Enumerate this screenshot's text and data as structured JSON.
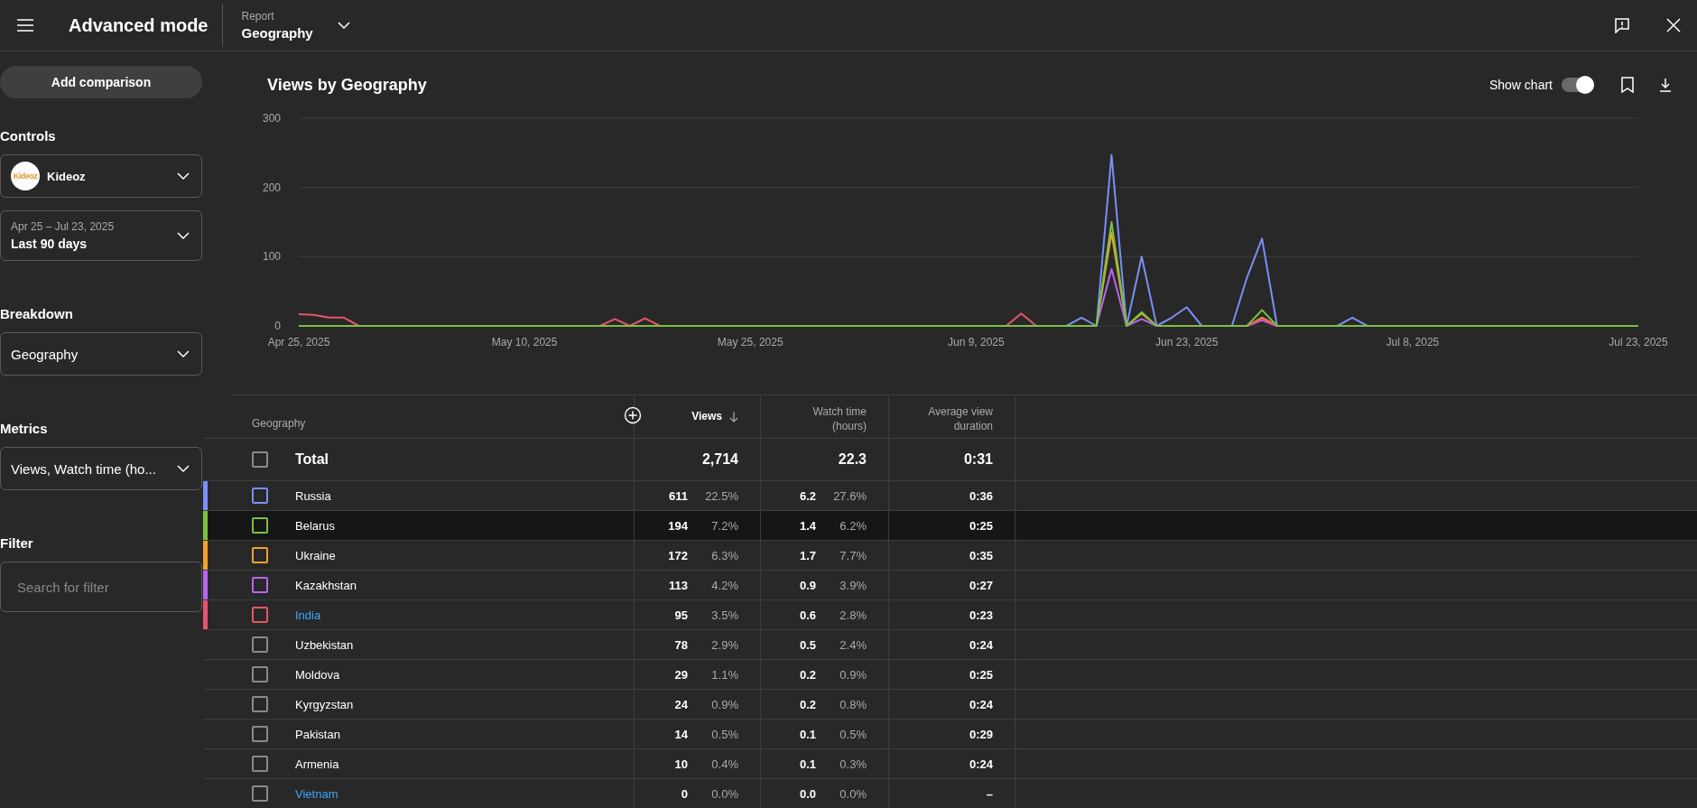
{
  "header": {
    "title": "Advanced mode",
    "report_label": "Report",
    "report_value": "Geography"
  },
  "sidebar": {
    "add_comparison": "Add comparison",
    "sections": [
      {
        "heading": "Controls",
        "fields": [
          {
            "kind": "channel",
            "value": "Kideoz",
            "logo": "Kideoz"
          },
          {
            "kind": "daterange",
            "caption": "Apr 25 – Jul 23, 2025",
            "value": "Last 90 days"
          }
        ]
      },
      {
        "heading": "Breakdown",
        "fields": [
          {
            "kind": "plain",
            "value": "Geography"
          }
        ]
      },
      {
        "heading": "Metrics",
        "fields": [
          {
            "kind": "plain",
            "value": "Views, Watch time (ho..."
          }
        ]
      },
      {
        "heading": "Filter",
        "fields": [
          {
            "kind": "search",
            "placeholder": "Search for filter"
          }
        ]
      }
    ]
  },
  "chart_panel": {
    "title": "Views by Geography",
    "show_chart_label": "Show chart",
    "show_chart_on": true,
    "chart_data": {
      "type": "line",
      "ylim": [
        0,
        300
      ],
      "yticks": [
        0,
        100,
        200,
        300
      ],
      "categories": [
        "Apr 25, 2025",
        null,
        null,
        null,
        null,
        null,
        null,
        null,
        null,
        null,
        null,
        null,
        null,
        null,
        null,
        "May 10, 2025",
        null,
        null,
        null,
        null,
        null,
        null,
        null,
        null,
        null,
        null,
        null,
        null,
        null,
        null,
        "May 25, 2025",
        null,
        null,
        null,
        null,
        null,
        null,
        null,
        null,
        null,
        null,
        null,
        null,
        null,
        null,
        "Jun 9, 2025",
        null,
        null,
        null,
        null,
        null,
        null,
        null,
        null,
        null,
        null,
        null,
        null,
        null,
        "Jun 23, 2025",
        null,
        null,
        null,
        null,
        null,
        null,
        null,
        null,
        null,
        null,
        null,
        null,
        null,
        null,
        "Jul 8, 2025",
        null,
        null,
        null,
        null,
        null,
        null,
        null,
        null,
        null,
        null,
        null,
        null,
        null,
        null,
        "Jul 23, 2025"
      ],
      "series": [
        {
          "color": "#7b8ff7",
          "values": [
            null,
            null,
            null,
            null,
            null,
            null,
            null,
            null,
            null,
            null,
            null,
            null,
            null,
            null,
            null,
            null,
            null,
            null,
            null,
            null,
            null,
            null,
            null,
            null,
            null,
            null,
            null,
            null,
            null,
            null,
            null,
            null,
            null,
            null,
            null,
            null,
            null,
            null,
            null,
            null,
            null,
            null,
            null,
            null,
            null,
            null,
            null,
            null,
            null,
            null,
            null,
            0,
            12,
            0,
            247,
            0,
            100,
            0,
            12,
            27,
            0,
            null,
            0,
            70,
            126,
            0,
            null,
            null,
            null,
            0,
            12,
            0,
            null,
            null,
            null,
            null,
            null,
            null,
            null,
            null,
            null,
            null,
            null,
            null,
            null,
            null,
            null,
            null,
            null,
            null
          ]
        },
        {
          "color": "#f2a22c",
          "values": [
            null,
            null,
            null,
            null,
            null,
            null,
            null,
            null,
            null,
            null,
            null,
            null,
            null,
            null,
            null,
            null,
            null,
            null,
            null,
            null,
            null,
            null,
            null,
            null,
            null,
            null,
            null,
            null,
            null,
            null,
            null,
            null,
            null,
            null,
            null,
            null,
            null,
            null,
            null,
            null,
            null,
            null,
            null,
            null,
            null,
            null,
            null,
            null,
            null,
            null,
            null,
            null,
            null,
            0,
            135,
            0,
            18,
            0,
            null,
            null,
            null,
            null,
            null,
            0,
            12,
            0,
            null,
            null,
            null,
            null,
            null,
            null,
            null,
            null,
            null,
            null,
            null,
            null,
            null,
            null,
            null,
            null,
            null,
            null,
            null,
            null,
            null,
            null,
            null,
            null
          ]
        },
        {
          "color": "#b666f0",
          "values": [
            null,
            null,
            null,
            null,
            null,
            null,
            null,
            null,
            null,
            null,
            null,
            null,
            null,
            null,
            null,
            null,
            null,
            null,
            null,
            null,
            null,
            null,
            null,
            null,
            null,
            null,
            null,
            null,
            null,
            null,
            null,
            null,
            null,
            null,
            null,
            null,
            null,
            null,
            null,
            null,
            null,
            null,
            null,
            null,
            null,
            null,
            null,
            null,
            null,
            null,
            null,
            null,
            null,
            0,
            82,
            0,
            10,
            0,
            null,
            null,
            null,
            null,
            null,
            0,
            8,
            0,
            null,
            null,
            null,
            null,
            null,
            null,
            null,
            null,
            null,
            null,
            null,
            null,
            null,
            null,
            null,
            null,
            null,
            null,
            null,
            null,
            null,
            null,
            null,
            null
          ]
        },
        {
          "color": "#e8546e",
          "values": [
            17,
            16,
            12,
            12,
            0,
            null,
            null,
            null,
            null,
            null,
            null,
            null,
            null,
            null,
            null,
            null,
            null,
            null,
            null,
            null,
            0,
            10,
            0,
            11,
            0,
            null,
            null,
            null,
            null,
            null,
            null,
            null,
            null,
            null,
            null,
            null,
            null,
            null,
            null,
            null,
            null,
            null,
            null,
            null,
            null,
            null,
            null,
            0,
            18,
            0,
            null,
            null,
            null,
            null,
            null,
            null,
            null,
            null,
            null,
            null,
            null,
            null,
            null,
            0,
            10,
            0,
            null,
            null,
            null,
            null,
            null,
            null,
            null,
            null,
            null,
            null,
            null,
            null,
            null,
            null,
            null,
            null,
            null,
            null,
            null,
            null,
            null,
            null,
            null,
            null
          ]
        },
        {
          "color": "#7ac142",
          "values": [
            0,
            0,
            0,
            0,
            0,
            0,
            0,
            0,
            0,
            0,
            0,
            0,
            0,
            0,
            0,
            0,
            0,
            0,
            0,
            0,
            0,
            0,
            0,
            0,
            0,
            0,
            0,
            0,
            0,
            0,
            0,
            0,
            0,
            0,
            0,
            0,
            0,
            0,
            0,
            0,
            0,
            0,
            0,
            0,
            0,
            0,
            0,
            0,
            0,
            0,
            0,
            0,
            0,
            0,
            150,
            0,
            20,
            0,
            0,
            0,
            0,
            0,
            0,
            0,
            23,
            0,
            0,
            0,
            0,
            0,
            0,
            0,
            0,
            0,
            0,
            0,
            0,
            0,
            0,
            0,
            0,
            0,
            0,
            0,
            0,
            0,
            0,
            0,
            0,
            0
          ]
        }
      ]
    }
  },
  "table": {
    "columns": [
      {
        "label": "Geography",
        "sorted": false
      },
      {
        "label": "Views",
        "sorted": true
      },
      {
        "label": "Watch time (hours)",
        "sorted": false
      },
      {
        "label": "Average view duration",
        "sorted": false
      }
    ],
    "total": {
      "label": "Total",
      "checked": false,
      "views": "2,714",
      "watch": "22.3",
      "avg": "0:31"
    },
    "rows": [
      {
        "name": "Russia",
        "color": "#7b8ff7",
        "checked": false,
        "link": false,
        "highlighted": false,
        "views": "611",
        "views_pct": "22.5%",
        "watch": "6.2",
        "watch_pct": "27.6%",
        "avg": "0:36"
      },
      {
        "name": "Belarus",
        "color": "#7ac142",
        "checked": false,
        "link": false,
        "highlighted": true,
        "views": "194",
        "views_pct": "7.2%",
        "watch": "1.4",
        "watch_pct": "6.2%",
        "avg": "0:25"
      },
      {
        "name": "Ukraine",
        "color": "#f2a22c",
        "checked": false,
        "link": false,
        "highlighted": false,
        "views": "172",
        "views_pct": "6.3%",
        "watch": "1.7",
        "watch_pct": "7.7%",
        "avg": "0:35"
      },
      {
        "name": "Kazakhstan",
        "color": "#b666f0",
        "checked": false,
        "link": false,
        "highlighted": false,
        "views": "113",
        "views_pct": "4.2%",
        "watch": "0.9",
        "watch_pct": "3.9%",
        "avg": "0:27"
      },
      {
        "name": "India",
        "color": "#e8546e",
        "checked": false,
        "link": true,
        "highlighted": false,
        "views": "95",
        "views_pct": "3.5%",
        "watch": "0.6",
        "watch_pct": "2.8%",
        "avg": "0:23"
      },
      {
        "name": "Uzbekistan",
        "checked": false,
        "link": false,
        "highlighted": false,
        "views": "78",
        "views_pct": "2.9%",
        "watch": "0.5",
        "watch_pct": "2.4%",
        "avg": "0:24"
      },
      {
        "name": "Moldova",
        "checked": false,
        "link": false,
        "highlighted": false,
        "views": "29",
        "views_pct": "1.1%",
        "watch": "0.2",
        "watch_pct": "0.9%",
        "avg": "0:25"
      },
      {
        "name": "Kyrgyzstan",
        "checked": false,
        "link": false,
        "highlighted": false,
        "views": "24",
        "views_pct": "0.9%",
        "watch": "0.2",
        "watch_pct": "0.8%",
        "avg": "0:24"
      },
      {
        "name": "Pakistan",
        "checked": false,
        "link": false,
        "highlighted": false,
        "views": "14",
        "views_pct": "0.5%",
        "watch": "0.1",
        "watch_pct": "0.5%",
        "avg": "0:29"
      },
      {
        "name": "Armenia",
        "checked": false,
        "link": false,
        "highlighted": false,
        "views": "10",
        "views_pct": "0.4%",
        "watch": "0.1",
        "watch_pct": "0.3%",
        "avg": "0:24"
      },
      {
        "name": "Vietnam",
        "checked": false,
        "link": true,
        "highlighted": false,
        "views": "0",
        "views_pct": "0.0%",
        "watch": "0.0",
        "watch_pct": "0.0%",
        "avg": "–"
      }
    ]
  }
}
